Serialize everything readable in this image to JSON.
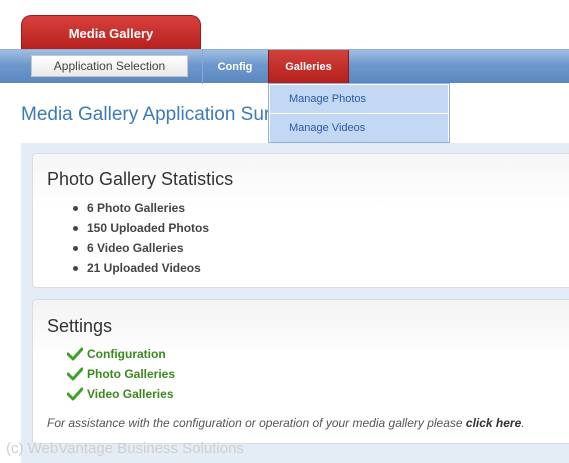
{
  "app_tab": {
    "label": "Media Gallery"
  },
  "menubar": {
    "app_selection_label": "Application Selection",
    "config_label": "Config",
    "galleries_label": "Galleries"
  },
  "dropdown": {
    "items": [
      {
        "label": "Manage Photos"
      },
      {
        "label": "Manage Videos"
      }
    ]
  },
  "page_title": "Media Gallery Application Sur",
  "stats_panel": {
    "heading": "Photo Gallery Statistics",
    "items": [
      "6 Photo Galleries",
      "150 Uploaded Photos",
      "6 Video Galleries",
      "21 Uploaded Videos"
    ]
  },
  "settings_panel": {
    "heading": "Settings",
    "links": [
      "Configuration",
      "Photo Galleries",
      "Video Galleries"
    ],
    "assistance_text": "For assistance with the configuration or operation of your media gallery please ",
    "assistance_link": "click here",
    "assistance_end": "."
  },
  "footer": "(c) WebVantage Business Solutions",
  "colors": {
    "accent_red": "#b3201c",
    "menubar_blue": "#6e98cc",
    "title_blue": "#3c7bb8",
    "link_green": "#3a8a1e"
  },
  "icons": [
    "bullet-icon",
    "checkmark-icon"
  ]
}
